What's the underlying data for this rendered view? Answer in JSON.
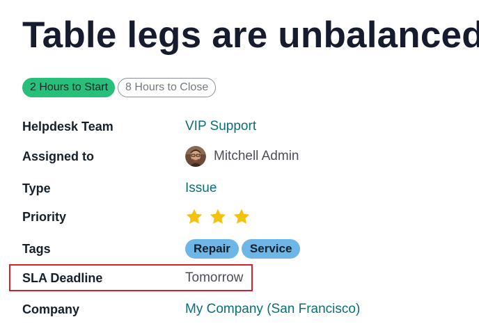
{
  "ticket": {
    "title": "Table legs are unbalanced"
  },
  "sla": {
    "start_label": "2 Hours to Start",
    "close_label": "8 Hours to Close"
  },
  "fields": {
    "helpdesk_team": {
      "label": "Helpdesk Team",
      "value": "VIP Support"
    },
    "assigned_to": {
      "label": "Assigned to",
      "value": "Mitchell Admin"
    },
    "type": {
      "label": "Type",
      "value": "Issue"
    },
    "priority": {
      "label": "Priority",
      "stars_filled": 3,
      "stars_total": 3
    },
    "tags": {
      "label": "Tags",
      "values": [
        "Repair",
        "Service"
      ]
    },
    "sla_deadline": {
      "label": "SLA Deadline",
      "value": "Tomorrow"
    },
    "company": {
      "label": "Company",
      "value": "My Company (San Francisco)"
    }
  },
  "colors": {
    "sla_start_badge": "#27bf7a",
    "link": "#0a6e76",
    "star": "#f3c20f",
    "tag": "#6db6e6",
    "highlight": "#d61f2a"
  }
}
